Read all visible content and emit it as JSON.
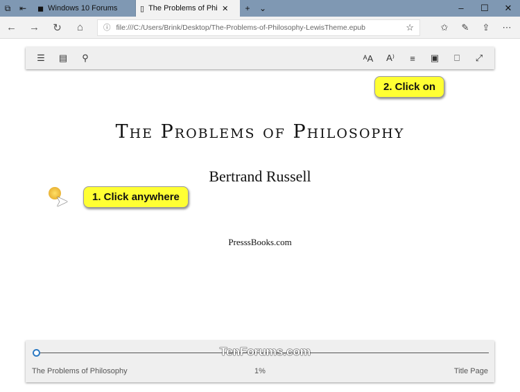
{
  "browser": {
    "tabs": [
      {
        "label": "Windows 10 Forums"
      },
      {
        "label": "The Problems of Philosophy"
      }
    ],
    "url": "file:///C:/Users/Brink/Desktop/The-Problems-of-Philosophy-LewisTheme.epub"
  },
  "book": {
    "title": "The Problems of Philosophy",
    "author": "Bertrand Russell",
    "publisher": "PresssBooks.com"
  },
  "callouts": {
    "one": "1. Click anywhere",
    "two": "2. Click on"
  },
  "footer": {
    "book_title": "The Problems of Philosophy",
    "progress": "1%",
    "progress_value": 1,
    "chapter": "Title Page",
    "watermark": "TenForums.com"
  },
  "colors": {
    "accent": "#2a78c2",
    "callout": "#ffff33"
  }
}
